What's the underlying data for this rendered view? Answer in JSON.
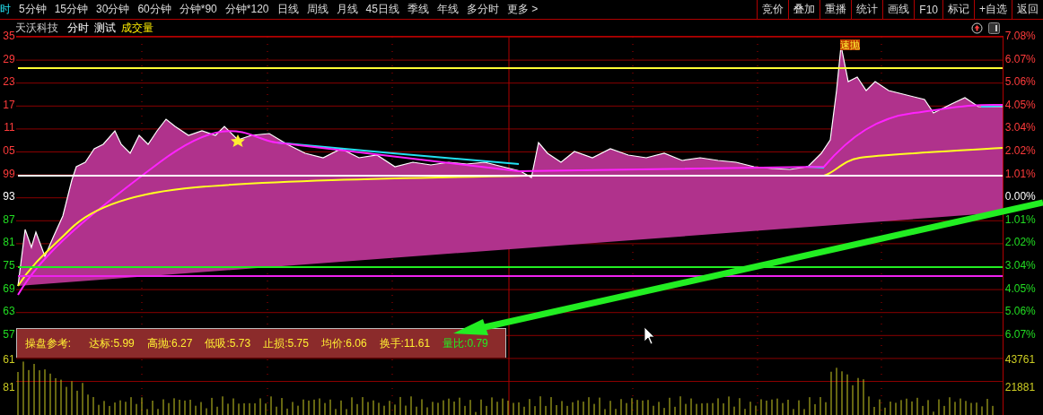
{
  "periods": [
    {
      "label": "时",
      "selected": true
    },
    {
      "label": "5分钟",
      "selected": false
    },
    {
      "label": "15分钟",
      "selected": false
    },
    {
      "label": "30分钟",
      "selected": false
    },
    {
      "label": "60分钟",
      "selected": false
    },
    {
      "label": "分钟*90",
      "selected": false
    },
    {
      "label": "分钟*120",
      "selected": false
    },
    {
      "label": "日线",
      "selected": false
    },
    {
      "label": "周线",
      "selected": false
    },
    {
      "label": "月线",
      "selected": false
    },
    {
      "label": "45日线",
      "selected": false
    },
    {
      "label": "季线",
      "selected": false
    },
    {
      "label": "年线",
      "selected": false
    },
    {
      "label": "多分时",
      "selected": false
    },
    {
      "label": "更多 >",
      "selected": false
    }
  ],
  "actions": [
    "竞价",
    "叠加",
    "重播",
    "统计",
    "画线",
    "F10",
    "标记",
    "+自选",
    "返回"
  ],
  "header": {
    "name": "天沃科技",
    "mode": "分时",
    "formula": "测试",
    "indicator": "成交量"
  },
  "left_axis": [
    {
      "label": "35",
      "kind": "up"
    },
    {
      "label": "29",
      "kind": "up"
    },
    {
      "label": "23",
      "kind": "up"
    },
    {
      "label": "17",
      "kind": "up"
    },
    {
      "label": "11",
      "kind": "up"
    },
    {
      "label": "05",
      "kind": "up"
    },
    {
      "label": "99",
      "kind": "up"
    },
    {
      "label": "93",
      "kind": "flat"
    },
    {
      "label": "87",
      "kind": "down"
    },
    {
      "label": "81",
      "kind": "down"
    },
    {
      "label": "75",
      "kind": "down"
    },
    {
      "label": "69",
      "kind": "down"
    },
    {
      "label": "63",
      "kind": "down"
    },
    {
      "label": "57",
      "kind": "down"
    },
    {
      "label": "61",
      "kind": "volume"
    },
    {
      "label": "81",
      "kind": "volume"
    }
  ],
  "right_axis": [
    {
      "label": "7.08%",
      "kind": "up"
    },
    {
      "label": "6.07%",
      "kind": "up"
    },
    {
      "label": "5.06%",
      "kind": "up"
    },
    {
      "label": "4.05%",
      "kind": "up"
    },
    {
      "label": "3.04%",
      "kind": "up"
    },
    {
      "label": "2.02%",
      "kind": "up"
    },
    {
      "label": "1.01%",
      "kind": "up"
    },
    {
      "label": "0.00%",
      "kind": "flat"
    },
    {
      "label": "1.01%",
      "kind": "down"
    },
    {
      "label": "2.02%",
      "kind": "down"
    },
    {
      "label": "3.04%",
      "kind": "down"
    },
    {
      "label": "4.05%",
      "kind": "down"
    },
    {
      "label": "5.06%",
      "kind": "down"
    },
    {
      "label": "6.07%",
      "kind": "down"
    },
    {
      "label": "43761",
      "kind": "volume"
    },
    {
      "label": "21881",
      "kind": "volume"
    }
  ],
  "signal": "速抛",
  "panel": {
    "title": "操盘参考:",
    "items": [
      {
        "label": "达标:5.99",
        "kind": "normal"
      },
      {
        "label": "高抛:6.27",
        "kind": "normal"
      },
      {
        "label": "低吸:5.73",
        "kind": "normal"
      },
      {
        "label": "止损:5.75",
        "kind": "normal"
      },
      {
        "label": "均价:6.06",
        "kind": "normal"
      },
      {
        "label": "换手:11.61",
        "kind": "normal"
      },
      {
        "label": "量比:0.79",
        "kind": "highlight"
      }
    ]
  }
}
